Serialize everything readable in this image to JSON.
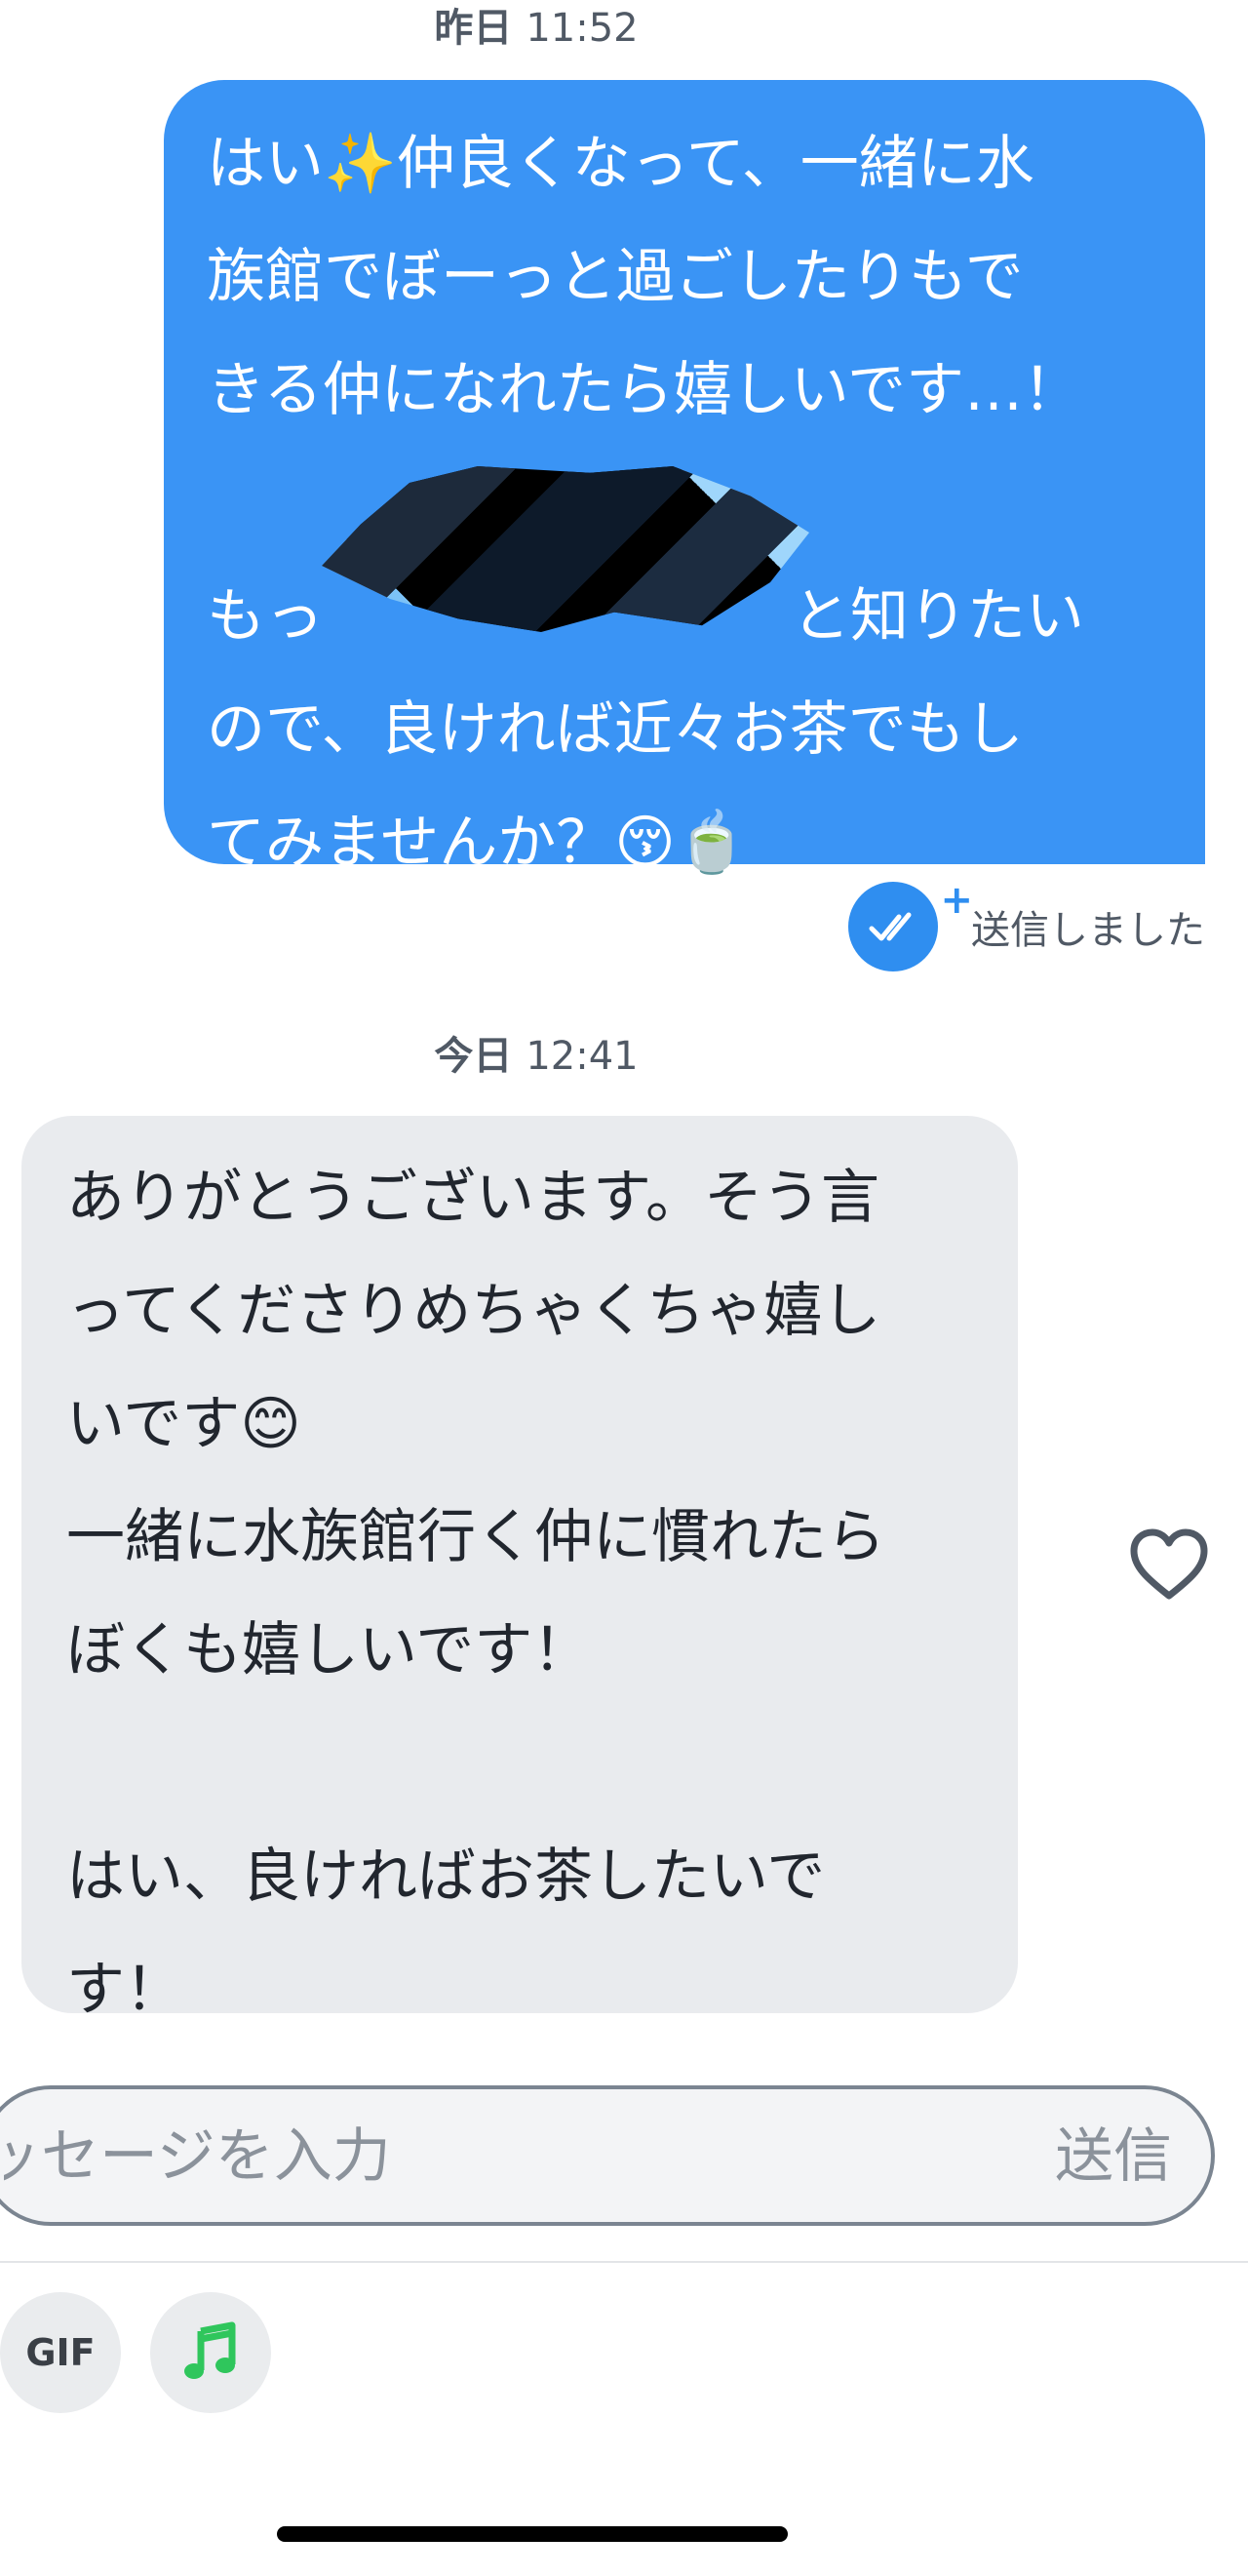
{
  "conversation": {
    "stamp_yesterday": {
      "day": "昨日",
      "time": "11:52"
    },
    "sent_message": {
      "text": "はい✨仲良くなって、一緒に水\n族館でぼーっと過ごしたりもで\nきる仲になれたら嬉しいです…！\n\nもっ　　　　　　　　と知りたい\nので、良ければ近々お茶でもし\nてみませんか？😚🍵",
      "status": "送信しました"
    },
    "stamp_today": {
      "day": "今日",
      "time": "12:41"
    },
    "received_message": {
      "text": "ありがとうございます。そう言\nってくださりめちゃくちゃ嬉し\nいです😊\n一緒に水族館行く仲に慣れたら\nぼくも嬉しいです！\n\nはい、良ければお茶したいで\nす！"
    }
  },
  "composer": {
    "placeholder": "ッセージを入力",
    "send_label": "送信"
  },
  "toolbar": {
    "gif_label": "GIF"
  },
  "colors": {
    "sent_bubble": "#3a94f5",
    "received_bubble": "#e9ebee",
    "accent": "#2f8ef0",
    "music": "#2fc65c"
  },
  "icons": {
    "read_receipt": "double-check-icon",
    "like": "heart-outline-icon",
    "music": "music-note-icon"
  }
}
